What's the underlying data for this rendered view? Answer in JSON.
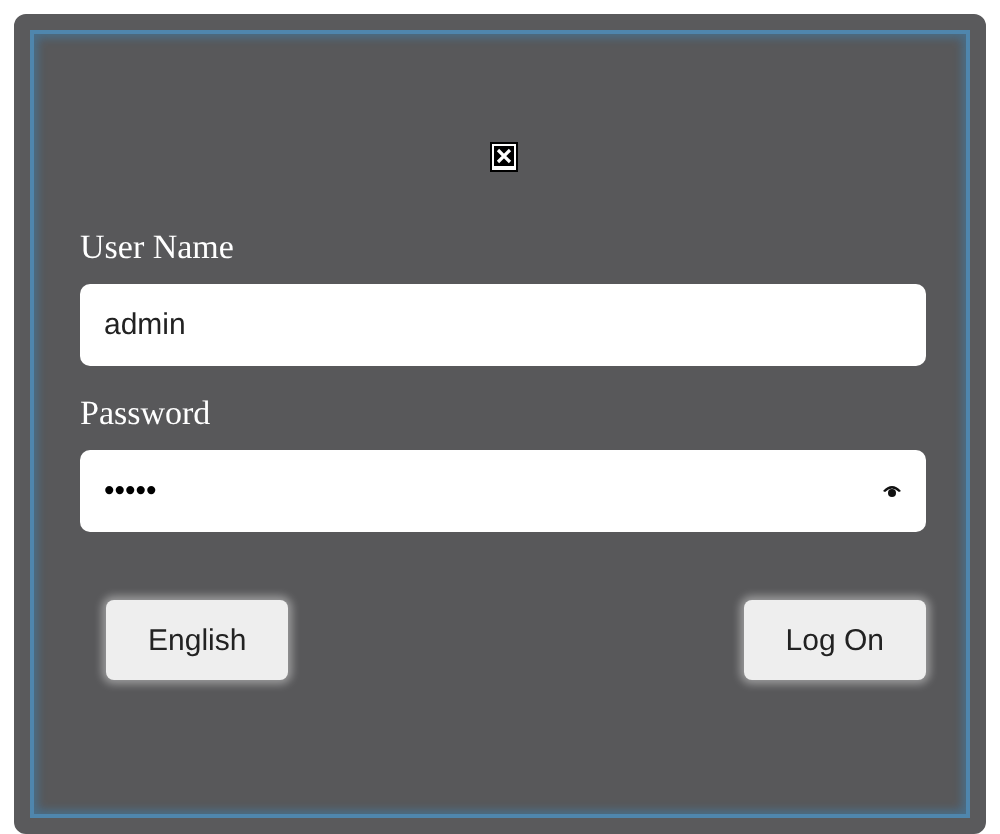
{
  "login": {
    "fields": [
      {
        "label": "User Name",
        "value": "admin",
        "kind": "text"
      },
      {
        "label": "Password",
        "value": "•••••",
        "kind": "password"
      }
    ],
    "buttons": [
      "English",
      "Log On"
    ]
  }
}
